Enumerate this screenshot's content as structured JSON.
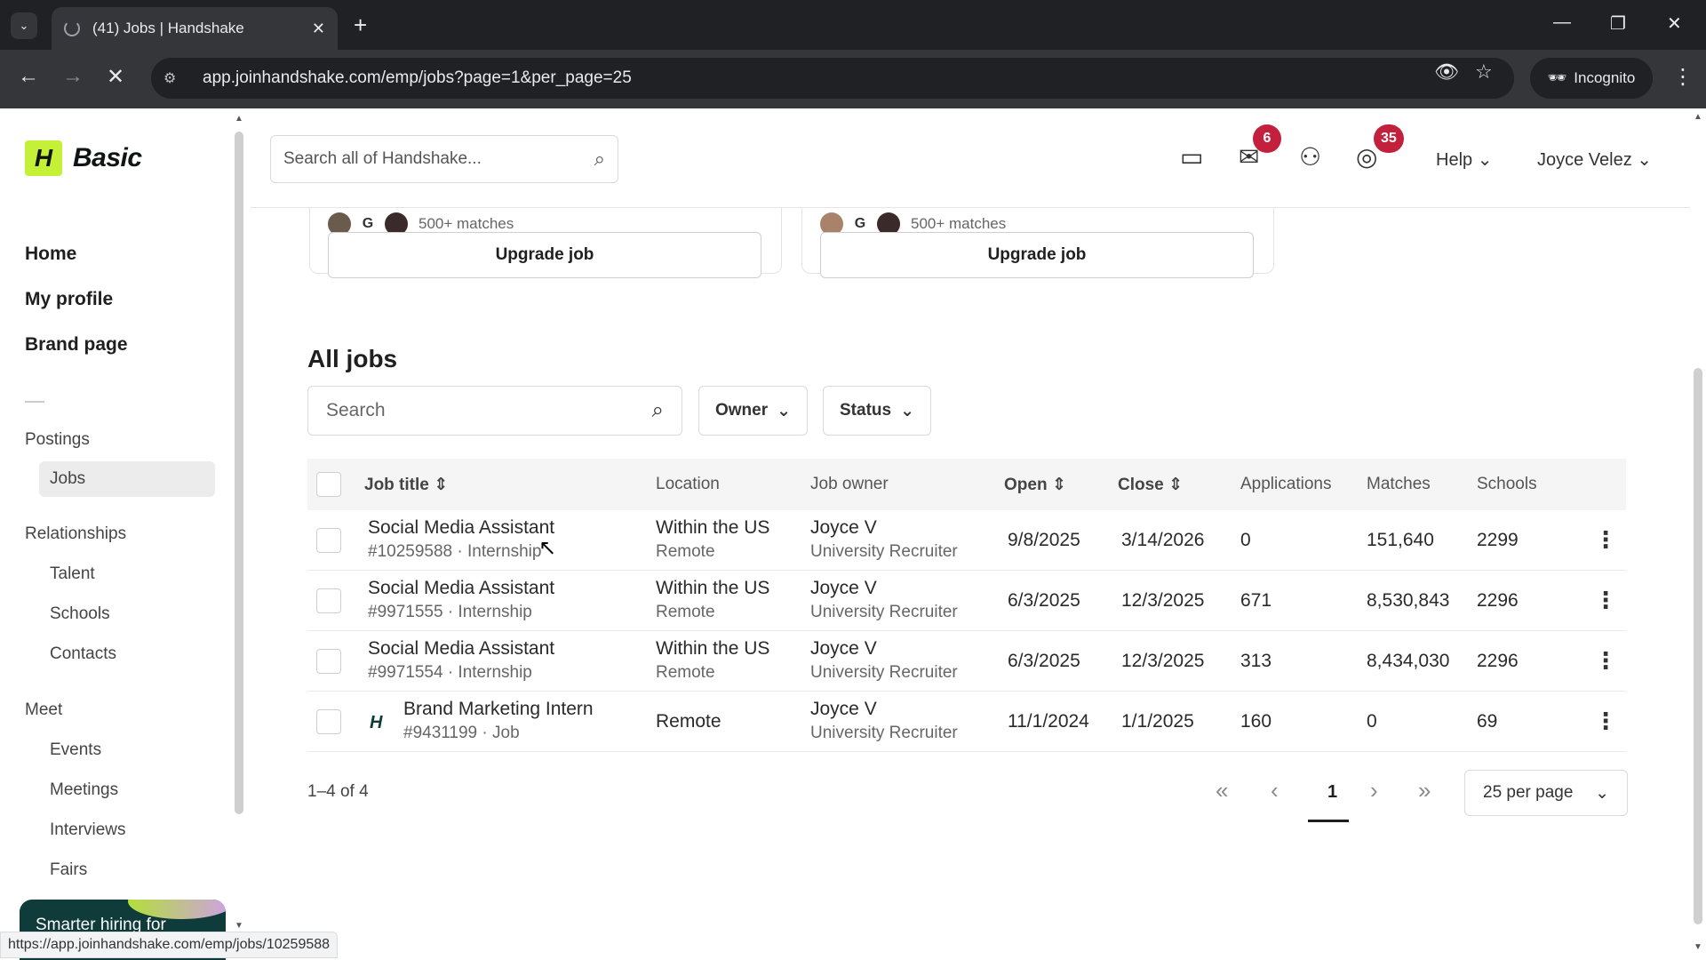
{
  "browser": {
    "tab_title": "(41) Jobs | Handshake",
    "url": "app.joinhandshake.com/emp/jobs?page=1&per_page=25",
    "incognito_label": "Incognito",
    "status_url": "https://app.joinhandshake.com/emp/jobs/10259588"
  },
  "brand": {
    "logo_letter": "H",
    "plan": "Basic"
  },
  "sidebar": {
    "main": [
      "Home",
      "My profile",
      "Brand page"
    ],
    "postings_label": "Postings",
    "jobs_label": "Jobs",
    "relationships_label": "Relationships",
    "relationships": [
      "Talent",
      "Schools",
      "Contacts"
    ],
    "meet_label": "Meet",
    "meet": [
      "Events",
      "Meetings",
      "Interviews",
      "Fairs"
    ],
    "promo_text": "Smarter hiring for"
  },
  "header": {
    "search_placeholder": "Search all of Handshake...",
    "messages_badge": "6",
    "notifications_badge": "35",
    "help_label": "Help",
    "user_name": "Joyce Velez"
  },
  "cards": [
    {
      "matches": "500+ matches",
      "button": "Upgrade job"
    },
    {
      "matches": "500+ matches",
      "button": "Upgrade job"
    }
  ],
  "jobs": {
    "title": "All jobs",
    "search_placeholder": "Search",
    "filters": [
      "Owner",
      "Status"
    ],
    "columns": [
      "Job title",
      "Location",
      "Job owner",
      "Open",
      "Close",
      "Applications",
      "Matches",
      "Schools"
    ],
    "rows": [
      {
        "title": "Social Media Assistant",
        "meta": "#10259588 · Internship",
        "location": "Within the US",
        "location_sub": "Remote",
        "owner": "Joyce V",
        "owner_role": "University Recruiter",
        "open": "9/8/2025",
        "close": "3/14/2026",
        "applications": "0",
        "matches": "151,640",
        "schools": "2299"
      },
      {
        "title": "Social Media Assistant",
        "meta": "#9971555 · Internship",
        "location": "Within the US",
        "location_sub": "Remote",
        "owner": "Joyce V",
        "owner_role": "University Recruiter",
        "open": "6/3/2025",
        "close": "12/3/2025",
        "applications": "671",
        "matches": "8,530,843",
        "schools": "2296"
      },
      {
        "title": "Social Media Assistant",
        "meta": "#9971554 · Internship",
        "location": "Within the US",
        "location_sub": "Remote",
        "owner": "Joyce V",
        "owner_role": "University Recruiter",
        "open": "6/3/2025",
        "close": "12/3/2025",
        "applications": "313",
        "matches": "8,434,030",
        "schools": "2296"
      },
      {
        "title": "Brand Marketing Intern",
        "meta": "#9431199 · Job",
        "location": "Remote",
        "location_sub": "",
        "owner": "Joyce V",
        "owner_role": "University Recruiter",
        "open": "11/1/2024",
        "close": "1/1/2025",
        "applications": "160",
        "matches": "0",
        "schools": "69"
      }
    ],
    "count_text": "1–4 of 4",
    "current_page": "1",
    "per_page": "25 per page"
  }
}
